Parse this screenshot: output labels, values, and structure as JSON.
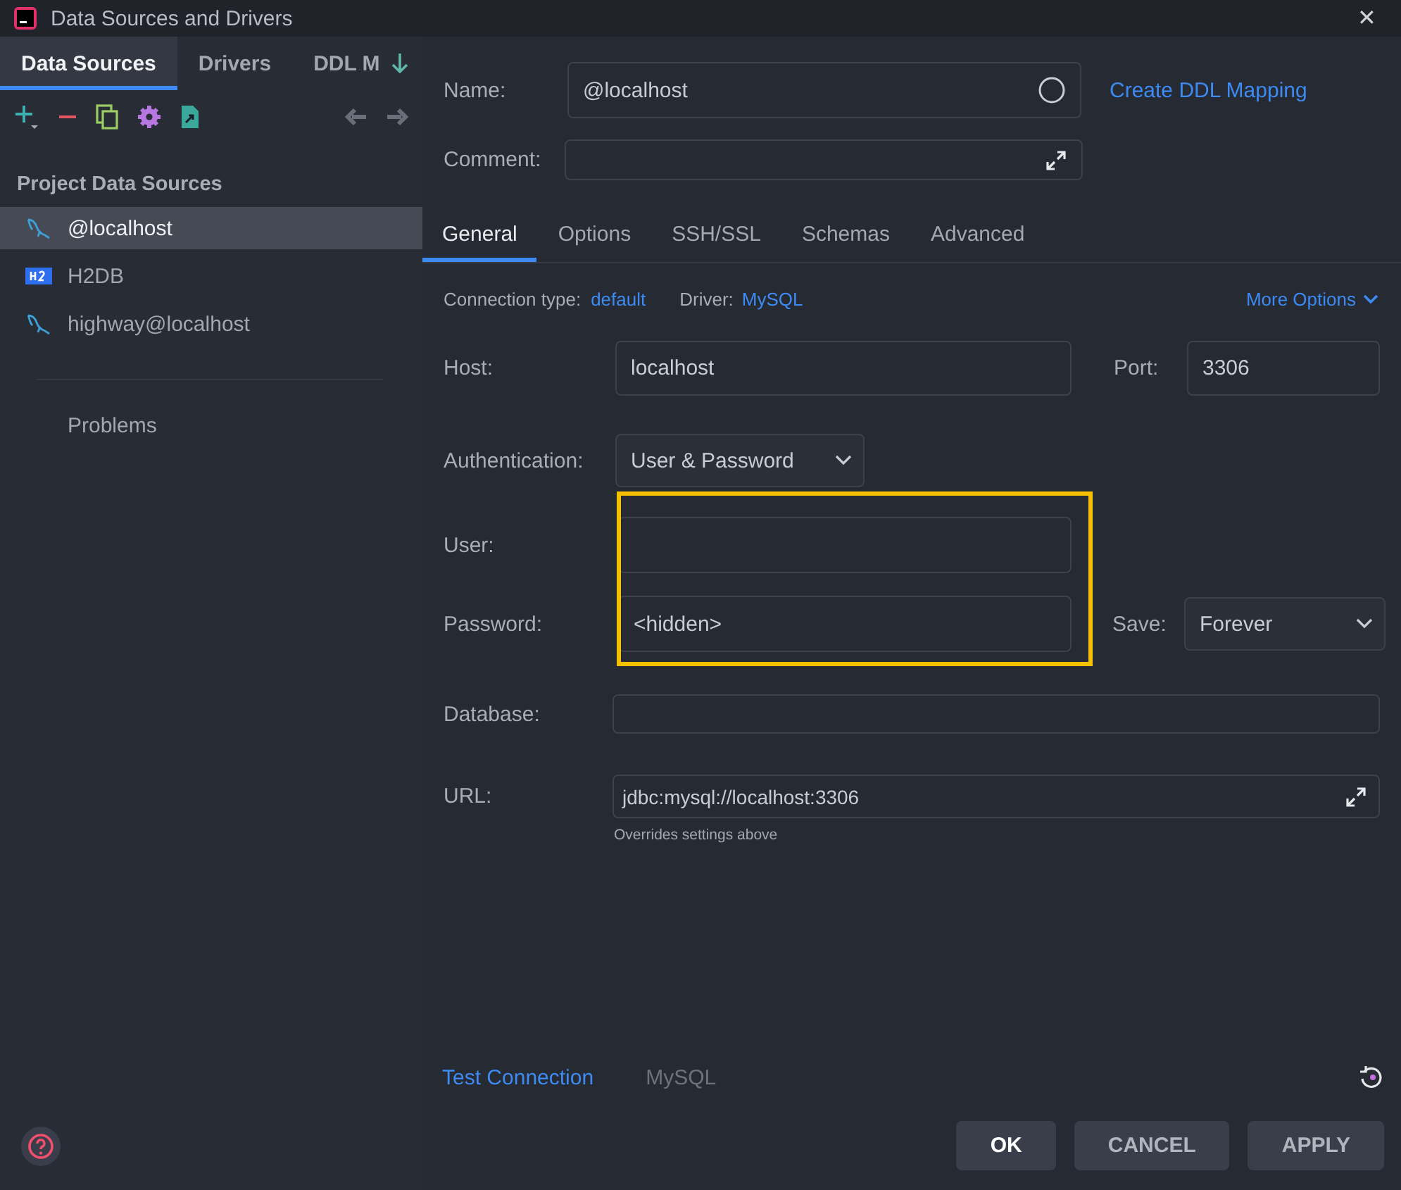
{
  "window": {
    "title": "Data Sources and Drivers",
    "close": "✕"
  },
  "left_tabs": [
    {
      "label": "Data Sources",
      "selected": true
    },
    {
      "label": "Drivers",
      "selected": false
    },
    {
      "label": "DDL M",
      "selected": false
    }
  ],
  "sidebar": {
    "section": "Project Data Sources",
    "items": [
      {
        "label": "@localhost",
        "kind": "mysql",
        "selected": true
      },
      {
        "label": "H2DB",
        "kind": "h2",
        "selected": false
      },
      {
        "label": "highway@localhost",
        "kind": "mysql",
        "selected": false
      }
    ],
    "problems": "Problems"
  },
  "name": {
    "label": "Name:",
    "value": "@localhost"
  },
  "create_ddl_link": "Create DDL Mapping",
  "comment": {
    "label": "Comment:"
  },
  "tabs": [
    {
      "label": "General",
      "selected": true
    },
    {
      "label": "Options",
      "selected": false
    },
    {
      "label": "SSH/SSL",
      "selected": false
    },
    {
      "label": "Schemas",
      "selected": false
    },
    {
      "label": "Advanced",
      "selected": false
    }
  ],
  "connection": {
    "type_label": "Connection type:",
    "type": "default",
    "driver_label": "Driver:",
    "driver": "MySQL",
    "more": "More Options"
  },
  "host": {
    "label": "Host:",
    "value": "localhost"
  },
  "port": {
    "label": "Port:",
    "value": "3306"
  },
  "authentication": {
    "label": "Authentication:",
    "value": "User & Password"
  },
  "user": {
    "label": "User:"
  },
  "password": {
    "label": "Password:",
    "value": "<hidden>"
  },
  "save": {
    "label": "Save:",
    "value": "Forever"
  },
  "database": {
    "label": "Database:"
  },
  "url": {
    "label": "URL:",
    "value": "jdbc:mysql://localhost:3306",
    "hint": "Overrides settings above"
  },
  "footer": {
    "test": "Test Connection",
    "driver": "MySQL"
  },
  "buttons": [
    {
      "label": "OK",
      "primary": true
    },
    {
      "label": "CANCEL",
      "primary": false
    },
    {
      "label": "APPLY",
      "primary": false
    }
  ]
}
